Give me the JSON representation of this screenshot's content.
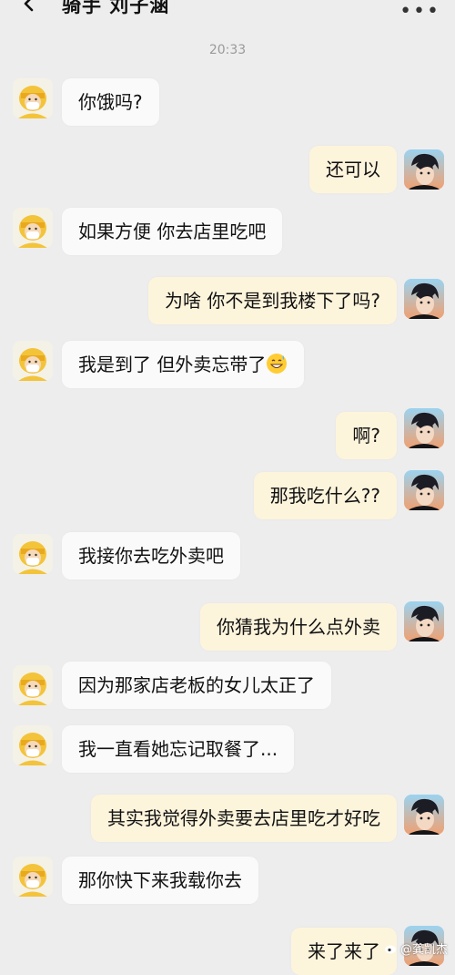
{
  "header": {
    "title": "骑手 刘子涵",
    "back_icon": "chevron-left-icon",
    "more_icon": "more-icon"
  },
  "timestamp": "20:33",
  "messages": [
    {
      "side": "left",
      "text": "你饿吗?"
    },
    {
      "side": "right",
      "text": "还可以"
    },
    {
      "side": "left",
      "text": "如果方便 你去店里吃吧"
    },
    {
      "side": "right",
      "text": "为啥 你不是到我楼下了吗?"
    },
    {
      "side": "left",
      "text": "我是到了 但外卖忘带了",
      "emoji": "grin-sweat-emoji"
    },
    {
      "side": "right",
      "text": "啊?"
    },
    {
      "side": "right",
      "text": "那我吃什么??"
    },
    {
      "side": "left",
      "text": "我接你去吃外卖吧"
    },
    {
      "side": "right",
      "text": "你猜我为什么点外卖"
    },
    {
      "side": "left",
      "text": "因为那家店老板的女儿太正了"
    },
    {
      "side": "left",
      "text": "我一直看她忘记取餐了..."
    },
    {
      "side": "right",
      "text": "其实我觉得外卖要去店里吃才好吃"
    },
    {
      "side": "left",
      "text": "那你快下来我载你去"
    },
    {
      "side": "right",
      "text": "来了来了"
    }
  ],
  "watermark": "@龚凯杰",
  "colors": {
    "background": "#ededed",
    "bubble_left": "#fafafa",
    "bubble_right": "#fdf4dc"
  }
}
